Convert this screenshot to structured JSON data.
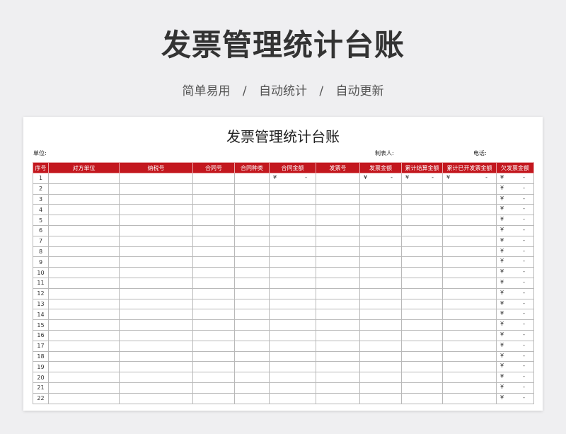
{
  "banner": {
    "title": "发票管理统计台账",
    "subtitle": [
      "简单易用",
      "自动统计",
      "自动更新"
    ],
    "separator": "/"
  },
  "sheet": {
    "title": "发票管理统计台账",
    "unit_label": "单位:",
    "maker_label": "制表人:",
    "phone_label": "电话:",
    "columns": [
      "序号",
      "对方单位",
      "纳税号",
      "合同号",
      "合同种类",
      "合同金额",
      "发票号",
      "发票金额",
      "累计结算金额",
      "累计已开发票金额",
      "欠发票金额"
    ],
    "currency_symbol": "¥",
    "empty_amount": "-",
    "first_row_money_columns": [
      "合同金额",
      "发票金额",
      "累计结算金额",
      "累计已开发票金额",
      "欠发票金额"
    ],
    "other_rows_money_columns": [
      "欠发票金额"
    ],
    "row_numbers": [
      "1",
      "2",
      "3",
      "4",
      "5",
      "6",
      "7",
      "8",
      "9",
      "10",
      "11",
      "12",
      "13",
      "14",
      "15",
      "16",
      "17",
      "18",
      "19",
      "20",
      "21",
      "22"
    ]
  },
  "colors": {
    "header_red": "#c3171e",
    "background": "#efeff1"
  }
}
